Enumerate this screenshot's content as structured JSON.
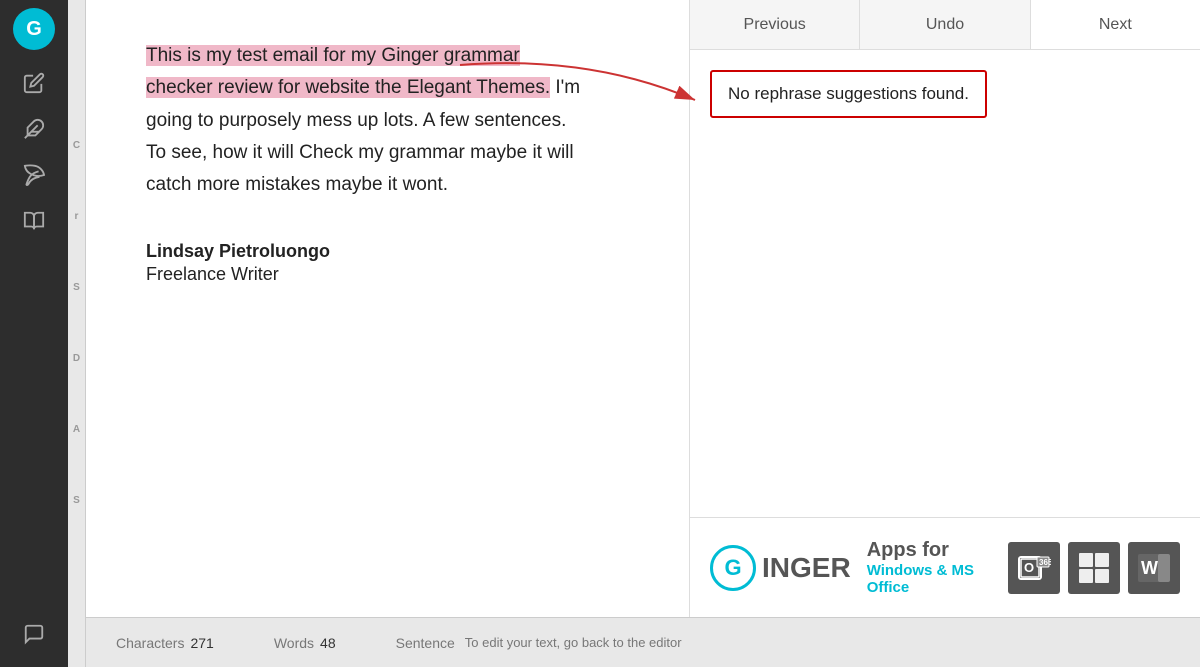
{
  "sidebar": {
    "logo": "G",
    "items": [
      {
        "id": "edit-icon",
        "symbol": "✏",
        "label": ""
      },
      {
        "id": "feather-icon",
        "symbol": "🖊",
        "label": ""
      },
      {
        "id": "leaf-icon",
        "symbol": "🍃",
        "label": ""
      },
      {
        "id": "book-icon",
        "symbol": "📖",
        "label": ""
      },
      {
        "id": "chat-icon",
        "symbol": "💬",
        "label": ""
      }
    ]
  },
  "left_letters": [
    "C",
    "r",
    "S",
    "D",
    "A",
    "S"
  ],
  "document": {
    "highlighted_text": "This is my test email for my Ginger grammar checker review for website the Elegant Themes.",
    "normal_text": " I'm going to purposely mess up lots. A few sentences. To see, how it will Check my grammar maybe it will catch more mistakes maybe it wont.",
    "author_name": "Lindsay Pietroluongo",
    "author_title": "Freelance Writer"
  },
  "toolbar": {
    "previous_label": "Previous",
    "undo_label": "Undo",
    "next_label": "Next"
  },
  "suggestion": {
    "message": "No rephrase suggestions found."
  },
  "ads": {
    "logo_letter": "G",
    "brand": "INGER",
    "line1": "Apps for",
    "line2": "Windows & MS Office"
  },
  "status_bar": {
    "characters_label": "Characters",
    "characters_value": "271",
    "words_label": "Words",
    "words_value": "48",
    "sentence_label": "Sentence",
    "sentence_text": "To edit your text, go back to the editor"
  }
}
